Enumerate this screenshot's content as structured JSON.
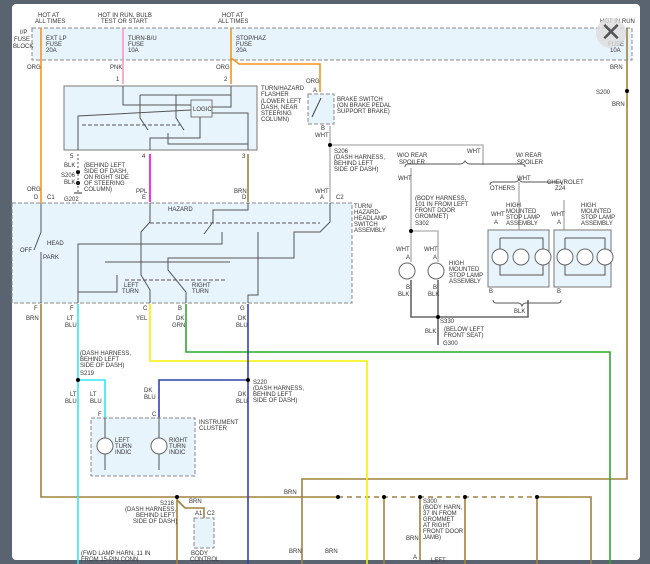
{
  "colors": {
    "org": "#f7941d",
    "pnk": "#f49ac1",
    "ppl": "#ec00ec",
    "brn": "#a08040",
    "wht": "#bbbbbb",
    "ltblu": "#33e6f0",
    "yel": "#f5f000",
    "dkgrn": "#2fa82f",
    "dkblu": "#3344aa",
    "blk": "#666666",
    "frame": "#5a6470",
    "panel": "#e8f4fc"
  },
  "close_icon": "close-icon",
  "fuse": {
    "hot1": [
      "HOT AT",
      "ALL TIMES"
    ],
    "hot2": [
      "HOT IN RUN, BULB",
      "TEST OR START"
    ],
    "hot3": [
      "HOT AT",
      "ALL TIMES"
    ],
    "hot4": "HOT IN RUN",
    "block": [
      "I/P",
      "FUSE",
      "BLOCK"
    ],
    "f1": [
      "EXT LP",
      "FUSE",
      "20A"
    ],
    "f2": [
      "TURN-B/U",
      "FUSE",
      "10A"
    ],
    "f3": [
      "STOP/HAZ",
      "FUSE",
      "20A"
    ],
    "f4": [
      "FUSE",
      "10A"
    ]
  },
  "wires": {
    "org": "ORG",
    "pnk": "PNK",
    "ppl": "PPL",
    "brn": "BRN",
    "wht": "WHT",
    "blk": "BLK",
    "lt": "LT",
    "blu": "BLU",
    "yel": "YEL",
    "dk": "DK",
    "grn": "GRN"
  },
  "flasher": {
    "label": [
      "TURN/HAZARD",
      "FLASHER",
      "(LOWER LEFT",
      "DASH, NEAR",
      "STEERING",
      "COLUMN)"
    ],
    "logic": "LOGIC",
    "p1": "1",
    "p2": "2",
    "p3": "3",
    "p4": "4",
    "p5": "5"
  },
  "s206a": {
    "id": "S206",
    "note": [
      "(BEHIND LEFT",
      "SIDE OF DASH,",
      "ON RIGHT SIDE",
      "OF STEERING",
      "COLUMN)"
    ],
    "ground": "G202"
  },
  "brake": {
    "label": [
      "BRAKE SWITCH",
      "(ON BRAKE PEDAL",
      "SUPPORT BRAKE)"
    ],
    "a": "A",
    "b": "B"
  },
  "s206b": {
    "label": [
      "S206",
      "(DASH HARNESS,",
      "BEHIND LEFT",
      "SIDE OF DASH)"
    ]
  },
  "switch": {
    "label": [
      "TURN/",
      "HAZARD-",
      "HEADLAMP",
      "SWITCH",
      "ASSEMBLY"
    ],
    "hazard": "HAZARD",
    "off": "OFF",
    "head": "HEAD",
    "park": "PARK",
    "left": [
      "LEFT",
      "TURN"
    ],
    "right": [
      "RIGHT",
      "TURN"
    ],
    "pins": {
      "d": "D",
      "c1": "C1",
      "e": "E",
      "d2": "D",
      "a": "A",
      "c2": "C2",
      "f": "F",
      "f2": "F",
      "c": "C",
      "b": "B",
      "g": "G"
    }
  },
  "spoiler": {
    "wo": [
      "W/O REAR",
      "SPOILER"
    ],
    "w": [
      "W/ REAR",
      "SPOILER"
    ],
    "others": "OTHERS",
    "chev": [
      "CHEVROLET",
      "Z24"
    ],
    "s302": [
      "(BODY HARNESS,",
      "101 IN FROM LEFT",
      "FRONT DOOR",
      "GROMMET)",
      "S302"
    ],
    "hmsl": [
      "HIGH",
      "MOUNTED",
      "STOP LAMP",
      "ASSEMBLY"
    ],
    "a": "A",
    "b": "B",
    "s330": "S330",
    "g300": "G300",
    "g300note": [
      "(BELOW LEFT",
      "FRONT SEAT)"
    ]
  },
  "s200": "S200",
  "s219": [
    "(DASH HARNESS,",
    "BEHIND LEFT",
    "SIDE OF DASH)",
    "S219"
  ],
  "s220": [
    "S220",
    "(DASH HARNESS,",
    "BEHIND LEFT",
    "SIDE OF DASH)"
  ],
  "cluster": {
    "label": [
      "INSTRUMENT",
      "CLUSTER"
    ],
    "left": [
      "LEFT",
      "TURN",
      "INDIC"
    ],
    "right": [
      "RIGHT",
      "TURN",
      "INDIC"
    ],
    "f": "F",
    "c": "C"
  },
  "s216": [
    "S216",
    "(DASH HARNESS,",
    "BEHIND LEFT",
    "SIDE OF DASH)"
  ],
  "bcm": {
    "label": [
      "BODY",
      "CONTROL"
    ],
    "a1": "A1",
    "c2": "C2"
  },
  "fwd": [
    "(FWD LAMP HARN, 11 IN",
    "FROM 15-PIN CONN"
  ],
  "s300": [
    "S300",
    "(BODY HARN,",
    "37 IN FROM",
    "GROMMET",
    "AT RIGHT",
    "FRONT DOOR",
    "JAMB)"
  ],
  "left_bottom": "LEFT",
  "pin_a": "A"
}
